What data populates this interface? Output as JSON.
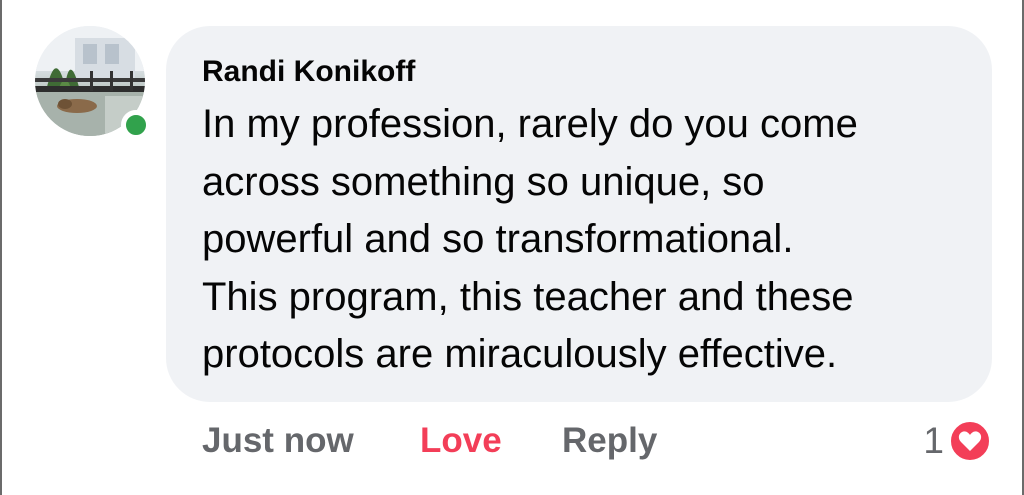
{
  "comment": {
    "author": "Randi Konikoff",
    "text": "In my profession, rarely do you come\nacross something so unique, so\npowerful and so transformational.\nThis program, this teacher and these\nprotocols are miraculously effective.",
    "online": true,
    "avatar_icon": "profile-photo"
  },
  "actions": {
    "time": "Just now",
    "love": "Love",
    "reply": "Reply"
  },
  "reactions": {
    "count": "1",
    "icon": "heart-icon"
  },
  "colors": {
    "bubble": "#f0f2f5",
    "love": "#f33e58",
    "muted": "#65676b",
    "online": "#31a24c"
  }
}
